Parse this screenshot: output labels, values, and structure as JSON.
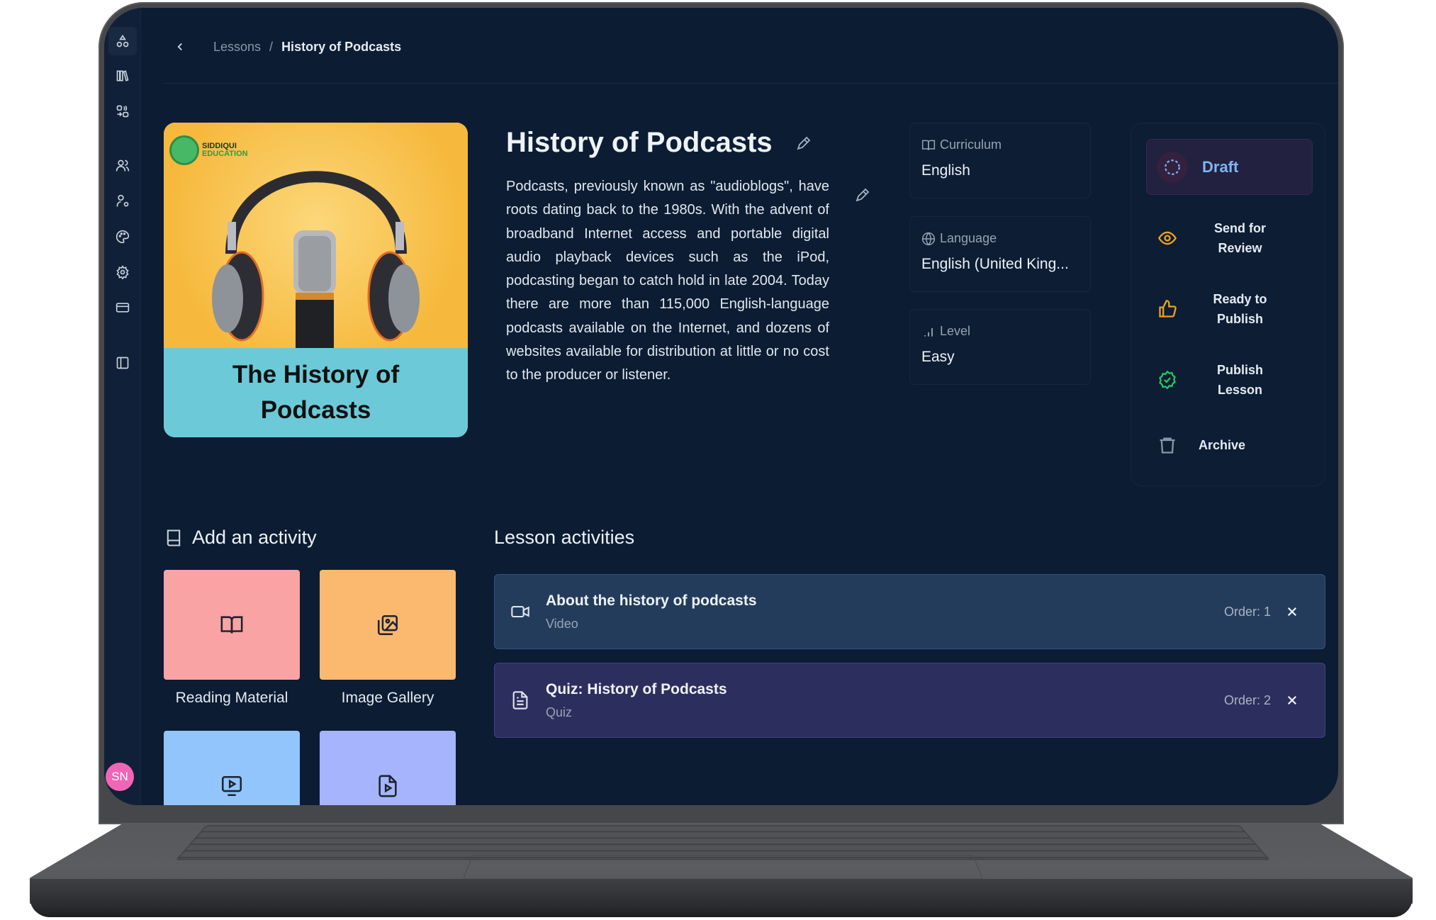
{
  "breadcrumb": {
    "back_icon": "chevron-left-icon",
    "items": [
      "Lessons",
      "History of Podcasts"
    ],
    "separator": "/"
  },
  "sidebar": {
    "items": [
      {
        "name": "shapes-icon",
        "active": true
      },
      {
        "name": "library-icon",
        "active": false
      },
      {
        "name": "activities-icon",
        "active": false
      },
      {
        "name": "users-icon",
        "active": false
      },
      {
        "name": "user-settings-icon",
        "active": false
      },
      {
        "name": "palette-icon",
        "active": false
      },
      {
        "name": "gear-icon",
        "active": false
      },
      {
        "name": "credit-card-icon",
        "active": false
      },
      {
        "name": "sidebar-toggle-icon",
        "active": false
      }
    ],
    "avatar_initials": "SN",
    "avatar_color": "#f066b6"
  },
  "lesson": {
    "cover": {
      "brand_line1": "SIDDIQUI",
      "brand_line2": "EDUCATION",
      "caption_line1": "The History of",
      "caption_line2": "Podcasts"
    },
    "title": "History of Podcasts",
    "description": "Podcasts, previously known as \"audioblogs\", have roots dating back to the 1980s. With the advent of broadband Internet access and portable digital audio playback devices such as the iPod, podcasting began to catch hold in late 2004. Today there are more than 115,000 English-language podcasts available on the Internet, and dozens of websites available for distribution at little or no cost to the producer or listener."
  },
  "info": {
    "curriculum": {
      "label": "Curriculum",
      "value": "English",
      "icon": "book-open-icon"
    },
    "language": {
      "label": "Language",
      "value": "English (United King...",
      "icon": "globe-icon"
    },
    "level": {
      "label": "Level",
      "value": "Easy",
      "icon": "signal-icon"
    }
  },
  "status": {
    "current": {
      "label": "Draft",
      "icon": "dashed-circle-icon",
      "color": "#7fb5f2"
    },
    "actions": [
      {
        "line1": "Send for",
        "line2": "Review",
        "icon": "eye-icon",
        "color": "#f0a020"
      },
      {
        "line1": "Ready to",
        "line2": "Publish",
        "icon": "thumbs-up-icon",
        "color": "#f0a020"
      },
      {
        "line1": "Publish",
        "line2": "Lesson",
        "icon": "badge-check-icon",
        "color": "#22c55e"
      },
      {
        "line1": "Archive",
        "line2": "",
        "icon": "trash-icon",
        "color": "#8a94a3"
      }
    ]
  },
  "add_activity": {
    "heading": "Add an activity",
    "tiles": [
      {
        "label": "Reading Material",
        "icon": "book-open-icon",
        "color": "#f9a3a4"
      },
      {
        "label": "Image Gallery",
        "icon": "images-icon",
        "color": "#fbb970"
      },
      {
        "label": "",
        "icon": "video-screen-icon",
        "color": "#93c5fd"
      },
      {
        "label": "",
        "icon": "file-play-icon",
        "color": "#a5b4fc"
      }
    ]
  },
  "lesson_activities": {
    "heading": "Lesson activities",
    "items": [
      {
        "title": "About the history of podcasts",
        "type": "Video",
        "order": "Order: 1",
        "icon": "video-camera-icon"
      },
      {
        "title": "Quiz: History of Podcasts",
        "type": "Quiz",
        "order": "Order: 2",
        "icon": "document-icon"
      }
    ]
  }
}
